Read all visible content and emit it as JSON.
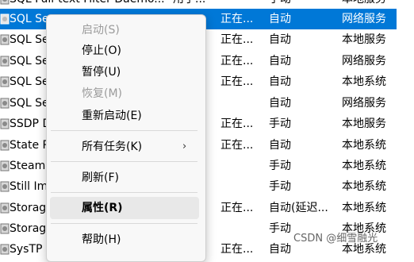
{
  "rows": [
    {
      "name": "SQL Full-text Filter Daemo...",
      "description": "用于...",
      "status": "",
      "startup": "手动",
      "logon": "本地服务",
      "selected": false
    },
    {
      "name": "SQL Se",
      "description": "",
      "status": "正在...",
      "startup": "自动",
      "logon": "网络服务",
      "selected": true
    },
    {
      "name": "SQL Se",
      "description": "",
      "status": "正在...",
      "startup": "自动",
      "logon": "本地服务",
      "selected": false
    },
    {
      "name": "SQL Se",
      "description": "",
      "status": "正在...",
      "startup": "自动",
      "logon": "网络服务",
      "selected": false
    },
    {
      "name": "SQL Se",
      "description": "",
      "status": "正在...",
      "startup": "自动",
      "logon": "本地系统",
      "selected": false
    },
    {
      "name": "SQL Se",
      "description": "",
      "status": "",
      "startup": "自动",
      "logon": "网络服务",
      "selected": false
    },
    {
      "name": "SSDP D",
      "description": "",
      "status": "正在...",
      "startup": "手动",
      "logon": "本地服务",
      "selected": false
    },
    {
      "name": "State R",
      "description": "",
      "status": "正在...",
      "startup": "自动",
      "logon": "本地系统",
      "selected": false
    },
    {
      "name": "Steam",
      "description": "",
      "status": "",
      "startup": "手动",
      "logon": "本地系统",
      "selected": false
    },
    {
      "name": "Still Im",
      "description": "",
      "status": "",
      "startup": "手动",
      "logon": "本地系统",
      "selected": false
    },
    {
      "name": "Storag",
      "description": "",
      "status": "正在...",
      "startup": "自动(延迟...",
      "logon": "本地系统",
      "selected": false
    },
    {
      "name": "Storag",
      "description": "",
      "status": "",
      "startup": "手动",
      "logon": "本地系统",
      "selected": false
    },
    {
      "name": "SysTP",
      "description": "",
      "status": "正在...",
      "startup": "自动",
      "logon": "本地系统",
      "selected": false
    }
  ],
  "context_menu": {
    "items": [
      {
        "label": "启动(S)",
        "disabled": true
      },
      {
        "label": "停止(O)",
        "disabled": false
      },
      {
        "label": "暂停(U)",
        "disabled": false
      },
      {
        "label": "恢复(M)",
        "disabled": true
      },
      {
        "label": "重新启动(E)",
        "disabled": false
      },
      {
        "label": "所有任务(K)",
        "disabled": false,
        "submenu": true,
        "arrow": "›"
      },
      {
        "label": "刷新(F)",
        "disabled": false
      },
      {
        "label": "属性(R)",
        "disabled": false,
        "bold": true,
        "highlighted": true
      },
      {
        "label": "帮助(H)",
        "disabled": false
      }
    ]
  },
  "watermark": "CSDN @细雪融光",
  "colors": {
    "selection": "#0078d7",
    "menu_bg": "#f8f8f8",
    "disabled_text": "#9b9b9b"
  }
}
